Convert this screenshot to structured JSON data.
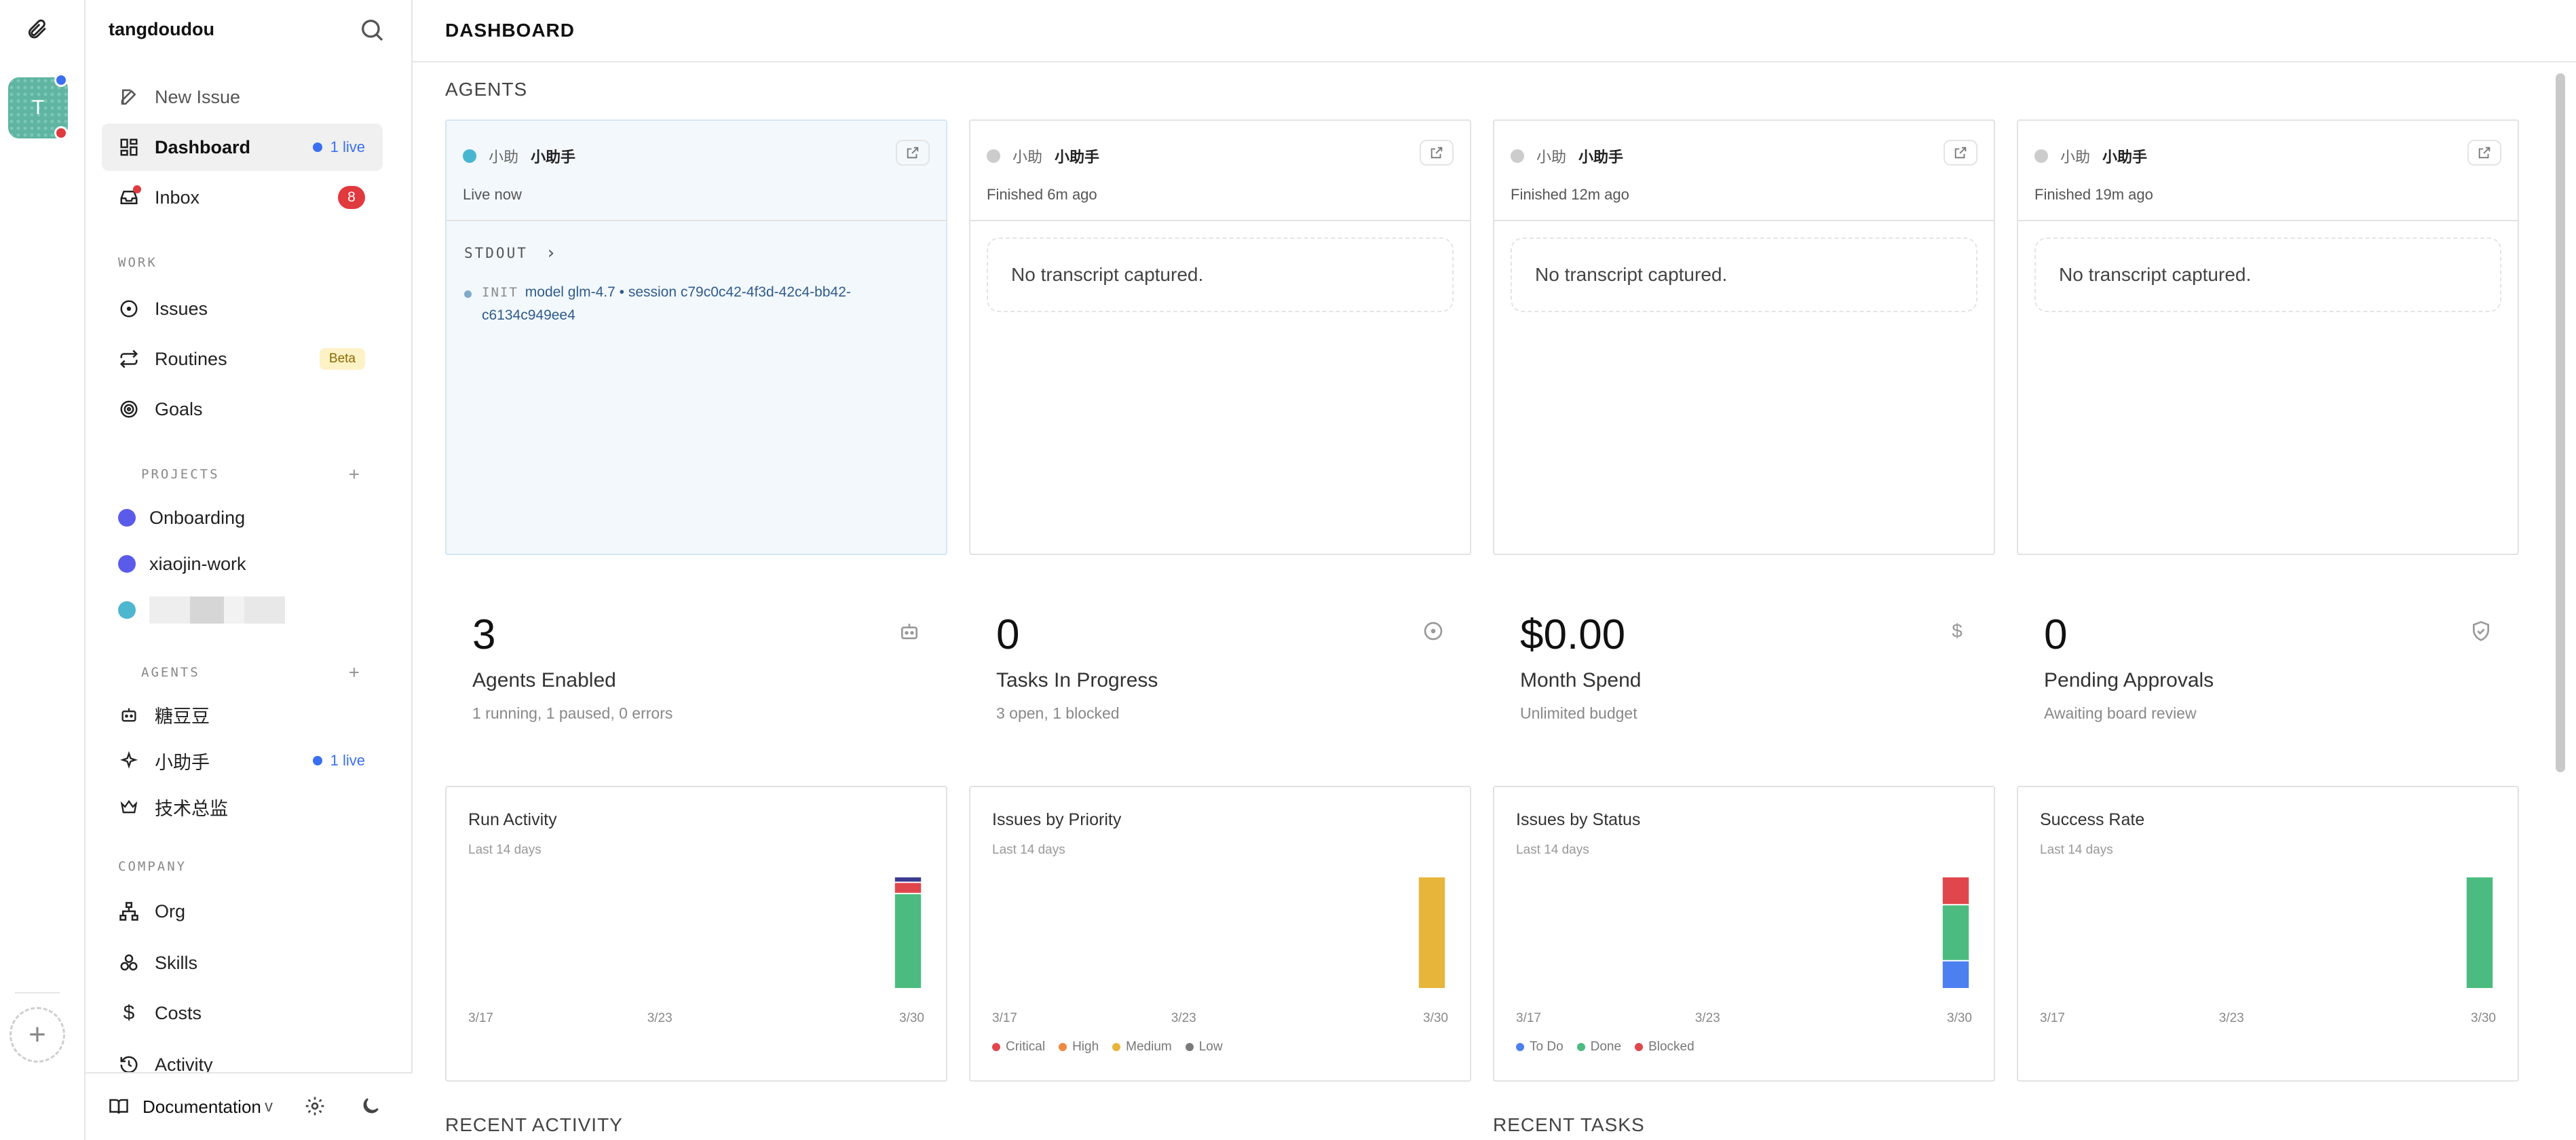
{
  "rail": {
    "avatar_letter": "T"
  },
  "sidebar": {
    "workspace": "tangdoudou",
    "new_issue": "New Issue",
    "dashboard": "Dashboard",
    "dashboard_live": "1 live",
    "inbox": "Inbox",
    "inbox_count": "8",
    "work_title": "WORK",
    "issues": "Issues",
    "routines": "Routines",
    "routines_badge": "Beta",
    "goals": "Goals",
    "projects_title": "PROJECTS",
    "projects": [
      {
        "name": "Onboarding",
        "color": "#5b5bea"
      },
      {
        "name": "xiaojin-work",
        "color": "#5b5bea"
      },
      {
        "name": "",
        "color": "#4fb6d0"
      }
    ],
    "agents_title": "AGENTS",
    "agents": [
      {
        "name": "糖豆豆",
        "icon": "robot-icon"
      },
      {
        "name": "小助手",
        "icon": "sparkles-icon",
        "live": "1 live"
      },
      {
        "name": "技术总监",
        "icon": "crown-icon"
      }
    ],
    "company_title": "COMPANY",
    "org": "Org",
    "skills": "Skills",
    "costs": "Costs",
    "activity": "Activity",
    "documentation": "Documentation",
    "doc_chevron": "v"
  },
  "header": {
    "title": "DASHBOARD"
  },
  "agents_section": {
    "title": "AGENTS",
    "cards": [
      {
        "tag": "小助",
        "name": "小助手",
        "status": "Live now",
        "live": true,
        "stdout_label": "STDOUT",
        "log_tag": "INIT",
        "log_text": "model glm-4.7 • session c79c0c42-4f3d-42c4-bb42-c6134c949ee4"
      },
      {
        "tag": "小助",
        "name": "小助手",
        "status": "Finished 6m ago",
        "live": false,
        "empty": "No transcript captured."
      },
      {
        "tag": "小助",
        "name": "小助手",
        "status": "Finished 12m ago",
        "live": false,
        "empty": "No transcript captured."
      },
      {
        "tag": "小助",
        "name": "小助手",
        "status": "Finished 19m ago",
        "live": false,
        "empty": "No transcript captured."
      }
    ]
  },
  "stats": [
    {
      "value": "3",
      "label": "Agents Enabled",
      "desc": "1 running, 1 paused, 0 errors",
      "icon": "robot-icon"
    },
    {
      "value": "0",
      "label": "Tasks In Progress",
      "desc": "3 open, 1 blocked",
      "icon": "circle-dot-icon"
    },
    {
      "value": "$0.00",
      "label": "Month Spend",
      "desc": "Unlimited budget",
      "icon": "dollar-icon"
    },
    {
      "value": "0",
      "label": "Pending Approvals",
      "desc": "Awaiting board review",
      "icon": "shield-check-icon"
    }
  ],
  "charts": [
    {
      "title": "Run Activity",
      "subtitle": "Last 14 days"
    },
    {
      "title": "Issues by Priority",
      "subtitle": "Last 14 days",
      "legend": [
        "Critical",
        "High",
        "Medium",
        "Low"
      ]
    },
    {
      "title": "Issues by Status",
      "subtitle": "Last 14 days",
      "legend": [
        "To Do",
        "Done",
        "Blocked"
      ]
    },
    {
      "title": "Success Rate",
      "subtitle": "Last 14 days"
    }
  ],
  "chart_data": [
    {
      "type": "bar",
      "title": "Run Activity",
      "subtitle": "Last 14 days",
      "x_ticks": [
        "3/17",
        "3/23",
        "3/30"
      ],
      "categories": [
        "3/17",
        "3/18",
        "3/19",
        "3/20",
        "3/21",
        "3/22",
        "3/23",
        "3/24",
        "3/25",
        "3/26",
        "3/27",
        "3/28",
        "3/29",
        "3/30"
      ],
      "series": [
        {
          "color": "#4cbb7f",
          "values": [
            0,
            0,
            0,
            0,
            0,
            0,
            0,
            0,
            0,
            0,
            0,
            0,
            0,
            17
          ]
        },
        {
          "color": "#e0474c",
          "values": [
            0,
            0,
            0,
            0,
            0,
            0,
            0,
            0,
            0,
            0,
            0,
            0,
            0,
            2
          ]
        },
        {
          "color": "#3b3b8f",
          "values": [
            0,
            0,
            0,
            0,
            0,
            0,
            0,
            0,
            0,
            0,
            0,
            0,
            0,
            1
          ]
        }
      ]
    },
    {
      "type": "bar",
      "title": "Issues by Priority",
      "subtitle": "Last 14 days",
      "x_ticks": [
        "3/17",
        "3/23",
        "3/30"
      ],
      "categories": [
        "3/17",
        "3/18",
        "3/19",
        "3/20",
        "3/21",
        "3/22",
        "3/23",
        "3/24",
        "3/25",
        "3/26",
        "3/27",
        "3/28",
        "3/29",
        "3/30"
      ],
      "legend": [
        "Critical",
        "High",
        "Medium",
        "Low"
      ],
      "series": [
        {
          "name": "Critical",
          "color": "#e0474c",
          "values": [
            0,
            0,
            0,
            0,
            0,
            0,
            0,
            0,
            0,
            0,
            0,
            0,
            0,
            0
          ]
        },
        {
          "name": "High",
          "color": "#f0883e",
          "values": [
            0,
            0,
            0,
            0,
            0,
            0,
            0,
            0,
            0,
            0,
            0,
            0,
            0,
            0
          ]
        },
        {
          "name": "Medium",
          "color": "#e6b53a",
          "values": [
            0,
            0,
            0,
            0,
            0,
            0,
            0,
            0,
            0,
            0,
            0,
            0,
            0,
            4
          ]
        },
        {
          "name": "Low",
          "color": "#7a7a7a",
          "values": [
            0,
            0,
            0,
            0,
            0,
            0,
            0,
            0,
            0,
            0,
            0,
            0,
            0,
            0
          ]
        }
      ]
    },
    {
      "type": "bar",
      "title": "Issues by Status",
      "subtitle": "Last 14 days",
      "x_ticks": [
        "3/17",
        "3/23",
        "3/30"
      ],
      "categories": [
        "3/17",
        "3/18",
        "3/19",
        "3/20",
        "3/21",
        "3/22",
        "3/23",
        "3/24",
        "3/25",
        "3/26",
        "3/27",
        "3/28",
        "3/29",
        "3/30"
      ],
      "legend": [
        "To Do",
        "Done",
        "Blocked"
      ],
      "series": [
        {
          "name": "To Do",
          "color": "#4c7ff0",
          "values": [
            0,
            0,
            0,
            0,
            0,
            0,
            0,
            0,
            0,
            0,
            0,
            0,
            0,
            1
          ]
        },
        {
          "name": "Done",
          "color": "#4cbb7f",
          "values": [
            0,
            0,
            0,
            0,
            0,
            0,
            0,
            0,
            0,
            0,
            0,
            0,
            0,
            2
          ]
        },
        {
          "name": "Blocked",
          "color": "#e0474c",
          "values": [
            0,
            0,
            0,
            0,
            0,
            0,
            0,
            0,
            0,
            0,
            0,
            0,
            0,
            1
          ]
        }
      ]
    },
    {
      "type": "bar",
      "title": "Success Rate",
      "subtitle": "Last 14 days",
      "x_ticks": [
        "3/17",
        "3/23",
        "3/30"
      ],
      "categories": [
        "3/17",
        "3/18",
        "3/19",
        "3/20",
        "3/21",
        "3/22",
        "3/23",
        "3/24",
        "3/25",
        "3/26",
        "3/27",
        "3/28",
        "3/29",
        "3/30"
      ],
      "series": [
        {
          "color": "#4cbb7f",
          "values": [
            0,
            0,
            0,
            0,
            0,
            0,
            0,
            0,
            0,
            0,
            0,
            0,
            0,
            90
          ]
        }
      ]
    }
  ],
  "recent": {
    "activity_title": "RECENT ACTIVITY",
    "tasks_title": "RECENT TASKS"
  }
}
